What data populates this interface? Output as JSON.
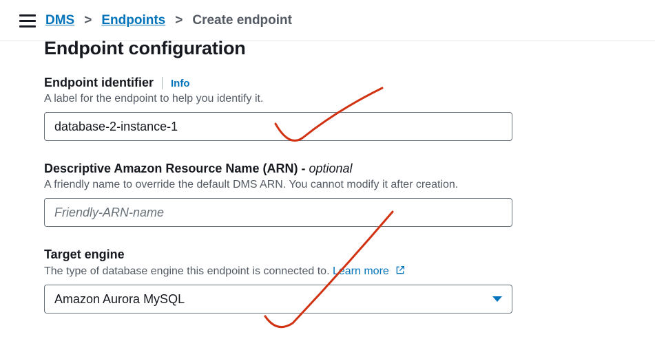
{
  "breadcrumb": {
    "root": "DMS",
    "l1": "Endpoints",
    "current": "Create endpoint"
  },
  "section": {
    "title": "Endpoint configuration"
  },
  "fields": {
    "identifier": {
      "label": "Endpoint identifier",
      "info": "Info",
      "help": "A label for the endpoint to help you identify it.",
      "value": "database-2-instance-1"
    },
    "arn": {
      "label": "Descriptive Amazon Resource Name (ARN) - ",
      "optional": "optional",
      "help": "A friendly name to override the default DMS ARN. You cannot modify it after creation.",
      "placeholder": "Friendly-ARN-name",
      "value": ""
    },
    "engine": {
      "label": "Target engine",
      "help_prefix": "The type of database engine this endpoint is connected to. ",
      "learn_more": "Learn more",
      "value": "Amazon Aurora MySQL"
    }
  }
}
